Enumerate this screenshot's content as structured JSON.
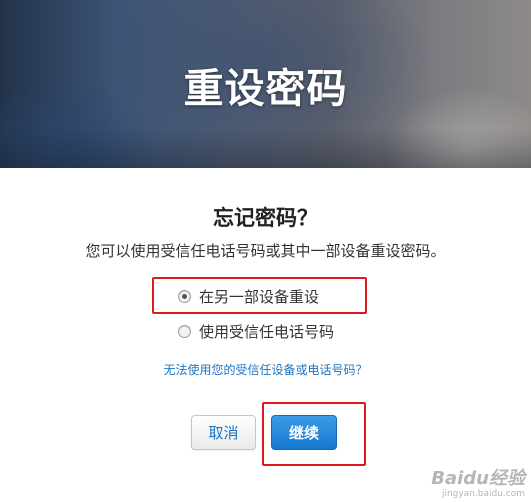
{
  "header": {
    "title": "重设密码"
  },
  "main": {
    "heading": "忘记密码？",
    "subtitle": "您可以使用受信任电话号码或其中一部设备重设密码。",
    "options": [
      {
        "label": "在另一部设备重设",
        "selected": true
      },
      {
        "label": "使用受信任电话号码",
        "selected": false
      }
    ],
    "help_link": "无法使用您的受信任设备或电话号码？",
    "buttons": {
      "cancel": "取消",
      "continue": "继续"
    }
  },
  "watermark": {
    "brand": "Baidu经验",
    "url": "jingyan.baidu.com"
  },
  "colors": {
    "link": "#1a74c5",
    "primary_button": "#1577d0",
    "highlight_box": "#e0191e"
  }
}
